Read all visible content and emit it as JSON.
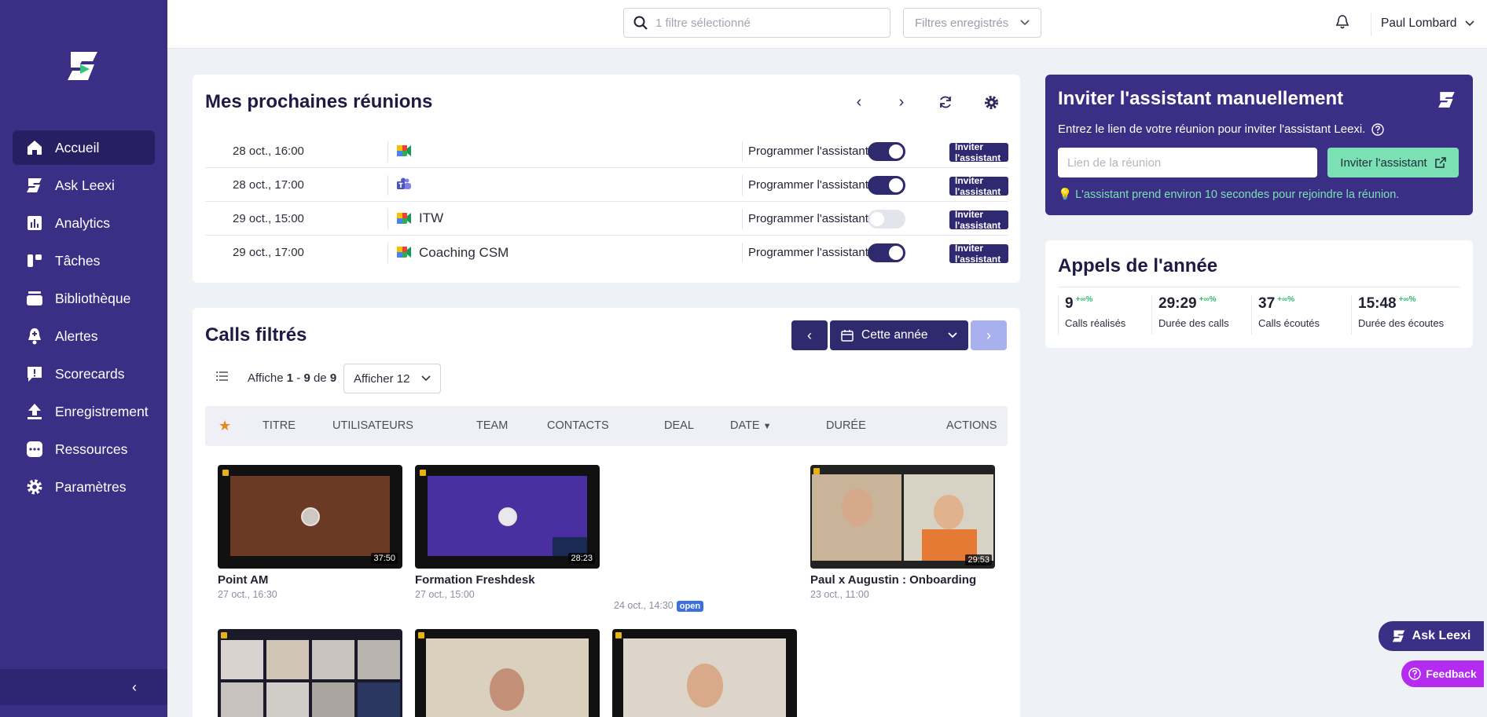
{
  "sidebar": {
    "items": [
      {
        "label": "Accueil",
        "icon": "home-icon"
      },
      {
        "label": "Ask Leexi",
        "icon": "leexi-icon"
      },
      {
        "label": "Analytics",
        "icon": "analytics-icon"
      },
      {
        "label": "Tâches",
        "icon": "tasks-icon"
      },
      {
        "label": "Bibliothèque",
        "icon": "library-icon"
      },
      {
        "label": "Alertes",
        "icon": "alert-bell-icon"
      },
      {
        "label": "Scorecards",
        "icon": "scorecard-icon"
      },
      {
        "label": "Enregistrement",
        "icon": "upload-icon"
      },
      {
        "label": "Ressources",
        "icon": "resources-icon"
      },
      {
        "label": "Paramètres",
        "icon": "gear-icon"
      }
    ]
  },
  "topbar": {
    "search_placeholder": "1 filtre sélectionné",
    "saved_filters": "Filtres enregistrés",
    "user_name": "Paul Lombard"
  },
  "meetings": {
    "title": "Mes prochaines réunions",
    "program_label": "Programmer l'assistant",
    "invite_label": "Inviter l'assistant",
    "rows": [
      {
        "date": "28 oct., 16:00",
        "app": "google-meet",
        "title": "",
        "enabled": true
      },
      {
        "date": "28 oct., 17:00",
        "app": "teams",
        "title": "",
        "enabled": true
      },
      {
        "date": "29 oct., 15:00",
        "app": "google-meet",
        "title": "ITW",
        "enabled": false
      },
      {
        "date": "29 oct., 17:00",
        "app": "google-meet",
        "title": "Coaching CSM",
        "enabled": true
      }
    ]
  },
  "calls": {
    "title": "Calls filtrés",
    "period": "Cette année",
    "showing_prefix": "Affiche",
    "showing_from": "1",
    "showing_sep": "-",
    "showing_to": "9",
    "showing_of": "de",
    "showing_total": "9",
    "per_page": "Afficher 12",
    "columns": [
      "TITRE",
      "UTILISATEURS",
      "TEAM",
      "CONTACTS",
      "DEAL",
      "DATE",
      "DURÉE",
      "ACTIONS"
    ],
    "tiles": [
      {
        "title": "Point AM",
        "date": "27 oct., 16:30",
        "duration": "37:50",
        "bg": "#6b3a25"
      },
      {
        "title": "Formation Freshdesk",
        "date": "27 oct., 15:00",
        "duration": "28:23",
        "bg": "#4a2fa0"
      },
      {
        "title": "",
        "date": "24 oct., 14:30",
        "badge": "open"
      },
      {
        "title": "Paul x Augustin : Onboarding",
        "date": "23 oct., 11:00",
        "duration": "29:53",
        "bg": "#c9b49a"
      }
    ]
  },
  "invite": {
    "title": "Inviter l'assistant manuellement",
    "subtitle": "Entrez le lien de votre réunion pour inviter l'assistant Leexi.",
    "placeholder": "Lien de la réunion",
    "button": "Inviter l'assistant",
    "hint": "💡 L'assistant prend environ 10 secondes pour rejoindre la réunion."
  },
  "stats": {
    "title": "Appels de l'année",
    "items": [
      {
        "value": "9",
        "delta": "+∞%",
        "label": "Calls réalisés"
      },
      {
        "value": "29:29",
        "delta": "+∞%",
        "label": "Durée des calls"
      },
      {
        "value": "37",
        "delta": "+∞%",
        "label": "Calls écoutés"
      },
      {
        "value": "15:48",
        "delta": "+∞%",
        "label": "Durée des écoutes"
      }
    ]
  },
  "floating": {
    "ask": "Ask Leexi",
    "feedback": "Feedback"
  },
  "colors": {
    "brand": "#3a2f85",
    "accent_green": "#7be0b3",
    "feedback": "#b32cf0"
  }
}
